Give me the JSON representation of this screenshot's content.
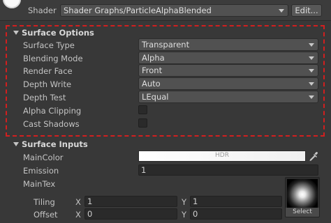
{
  "shader": {
    "label": "Shader",
    "value": "Shader Graphs/ParticleAlphaBlended",
    "edit_label": "Edit..."
  },
  "surface_options": {
    "title": "Surface Options",
    "properties": [
      {
        "label": "Surface Type",
        "value": "Transparent"
      },
      {
        "label": "Blending Mode",
        "value": "Alpha"
      },
      {
        "label": "Render Face",
        "value": "Front"
      },
      {
        "label": "Depth Write",
        "value": "Auto"
      },
      {
        "label": "Depth Test",
        "value": "LEqual"
      }
    ],
    "checkboxes": [
      {
        "label": "Alpha Clipping",
        "checked": false
      },
      {
        "label": "Cast Shadows",
        "checked": false
      }
    ],
    "highlight_color": "#d21f1f"
  },
  "surface_inputs": {
    "title": "Surface Inputs",
    "main_color": {
      "label": "MainColor",
      "badge": "HDR",
      "color": "#ffffff"
    },
    "emission": {
      "label": "Emission",
      "value": "1"
    },
    "main_tex": {
      "label": "MainTex",
      "select_label": "Select",
      "tiling": {
        "label": "Tiling",
        "x_label": "X",
        "x": "1",
        "y_label": "Y",
        "y": "1"
      },
      "offset": {
        "label": "Offset",
        "x_label": "X",
        "x": "0",
        "y_label": "Y",
        "y": "0"
      }
    }
  }
}
